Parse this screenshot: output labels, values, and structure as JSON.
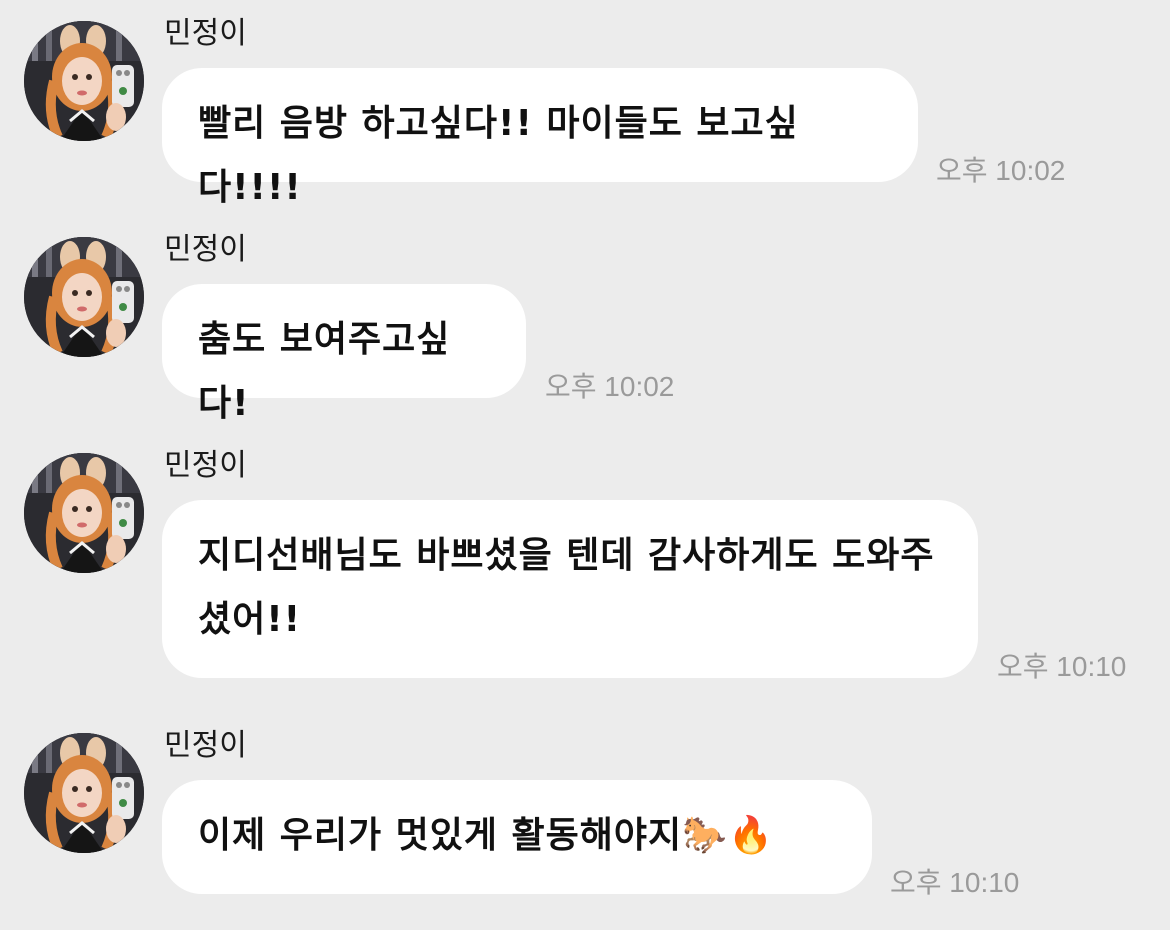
{
  "messages": [
    {
      "sender": "민정이",
      "text": "빨리 음방 하고싶다!! 마이들도 보고싶다!!!!",
      "time": "오후 10:02"
    },
    {
      "sender": "민정이",
      "text": "춤도 보여주고싶다!",
      "time": "오후 10:02"
    },
    {
      "sender": "민정이",
      "text": "지디선배님도 바쁘셨을 텐데 감사하게도 도와주셨어!!",
      "time": "오후 10:10"
    },
    {
      "sender": "민정이",
      "text": "이제 우리가 멋있게 활동해야지",
      "emoji": "🐎🔥",
      "time": "오후 10:10"
    }
  ],
  "colors": {
    "background": "#ececec",
    "bubble": "#ffffff",
    "timestamp": "#9a9a9a"
  }
}
